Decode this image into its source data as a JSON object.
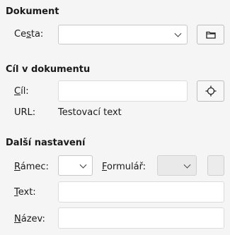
{
  "document": {
    "title": "Dokument",
    "path_label_pre": "Ce",
    "path_label_u": "s",
    "path_label_post": "ta:",
    "path_value": ""
  },
  "target": {
    "title": "Cíl v dokumentu",
    "target_label_u": "C",
    "target_label_post": "íl:",
    "target_value": "",
    "url_label": "URL:",
    "url_value": "Testovací text"
  },
  "more": {
    "title": "Další nastavení",
    "frame_label_u": "R",
    "frame_label_post": "ámec:",
    "frame_value": "",
    "form_label_u": "F",
    "form_label_post": "ormulář:",
    "form_value": "",
    "text_label_u": "T",
    "text_label_post": "ext:",
    "text_value": "",
    "name_label_u": "N",
    "name_label_post": "ázev:",
    "name_value": ""
  },
  "icons": {
    "open_file": "folder-icon",
    "target_picker": "target-crosshair-icon"
  }
}
